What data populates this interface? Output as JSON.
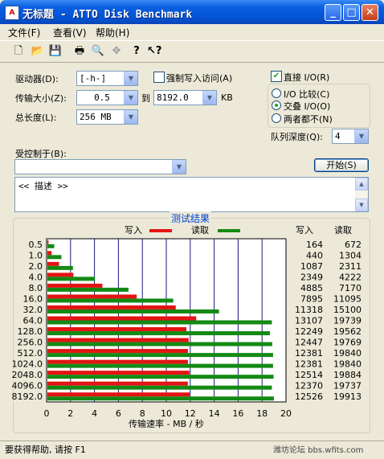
{
  "window": {
    "title": "无标题 - ATTO Disk Benchmark",
    "icon_text": "A"
  },
  "menu": [
    {
      "label": "文件(F)"
    },
    {
      "label": "查看(V)"
    },
    {
      "label": "帮助(H)"
    }
  ],
  "toolbar": {
    "icons": [
      "new-icon",
      "open-icon",
      "save-icon",
      "print-icon",
      "print-preview-icon",
      "move-icon",
      "help-icon",
      "context-help-icon"
    ]
  },
  "form": {
    "drive_label": "驱动器(D):",
    "drive_value": "[-h-]",
    "force_write_label": "强制写入访问(A)",
    "force_write_checked": false,
    "direct_io_label": "直接 I/O(R)",
    "direct_io_checked": true,
    "transfer_label": "传输大小(Z):",
    "transfer_from": "0.5",
    "to_label": "到",
    "transfer_to": "8192.0",
    "kb_label": "KB",
    "total_label": "总长度(L):",
    "total_value": "256 MB",
    "radio_options": [
      {
        "label": "I/O 比较(C)",
        "selected": false
      },
      {
        "label": "交叠 I/O(O)",
        "selected": true
      },
      {
        "label": "两者都不(N)",
        "selected": false
      }
    ],
    "queue_label": "队列深度(Q):",
    "queue_value": "4",
    "controlled_label": "受控制于(B):",
    "controlled_value": "",
    "start_button": "开始(S)",
    "description": "<< 描述 >>"
  },
  "results": {
    "title": "测试结果",
    "write_header": "写入",
    "read_header": "读取"
  },
  "chart_data": {
    "type": "bar",
    "orientation": "horizontal",
    "categories": [
      "0.5",
      "1.0",
      "2.0",
      "4.0",
      "8.0",
      "16.0",
      "32.0",
      "64.0",
      "128.0",
      "256.0",
      "512.0",
      "1024.0",
      "2048.0",
      "4096.0",
      "8192.0"
    ],
    "series": [
      {
        "name": "写入",
        "color": "#E31414",
        "values": [
          0.16,
          0.42,
          1.04,
          2.24,
          4.66,
          7.53,
          10.79,
          12.5,
          11.68,
          11.87,
          11.81,
          11.81,
          11.93,
          11.8,
          11.95
        ]
      },
      {
        "name": "读取",
        "color": "#148A14",
        "values": [
          0.64,
          1.24,
          2.2,
          4.03,
          6.84,
          10.58,
          14.4,
          18.82,
          18.66,
          18.85,
          18.92,
          18.92,
          18.96,
          18.82,
          18.99
        ]
      }
    ],
    "write_values": [
      "164",
      "440",
      "1087",
      "2349",
      "4885",
      "7895",
      "11318",
      "13107",
      "12249",
      "12447",
      "12381",
      "12381",
      "12514",
      "12370",
      "12526"
    ],
    "read_values": [
      "672",
      "1304",
      "2311",
      "4222",
      "7170",
      "11095",
      "15100",
      "19739",
      "19562",
      "19769",
      "19840",
      "19840",
      "19884",
      "19737",
      "19913"
    ],
    "xlabel": "传输速率 - MB / 秒",
    "xticks": [
      "0",
      "2",
      "4",
      "6",
      "8",
      "10",
      "12",
      "14",
      "16",
      "18",
      "20"
    ],
    "xlim": [
      0,
      20
    ],
    "grid": true,
    "legend": "top"
  },
  "status": {
    "left": "要获得帮助, 请按 F1",
    "right": "潍坊论坛 bbs.wfits.com"
  }
}
